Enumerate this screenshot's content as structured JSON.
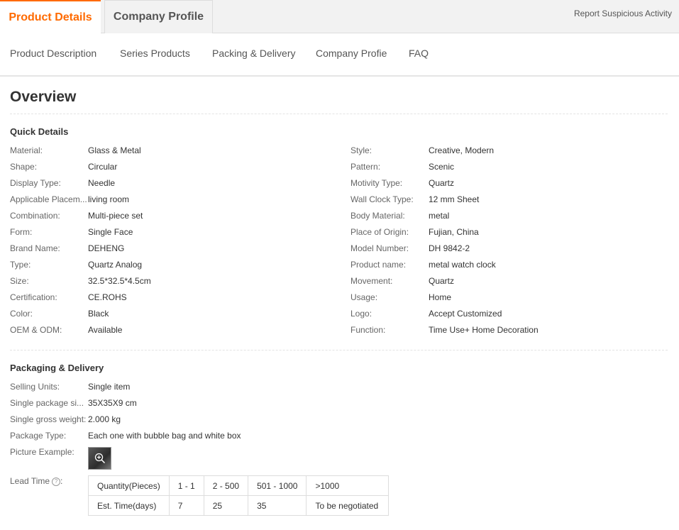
{
  "tabs": {
    "active": "Product Details",
    "company": "Company Profile"
  },
  "report_link": "Report Suspicious Activity",
  "subnav": [
    "Product Description",
    "Series Products",
    "Packing & Delivery",
    "Company Profie",
    "FAQ"
  ],
  "overview": {
    "title": "Overview"
  },
  "quick_details": {
    "title": "Quick Details",
    "left": [
      {
        "k": "Material:",
        "v": "Glass & Metal"
      },
      {
        "k": "Shape:",
        "v": "Circular"
      },
      {
        "k": "Display Type:",
        "v": "Needle"
      },
      {
        "k": "Applicable Placem...",
        "v": "living room"
      },
      {
        "k": "Combination:",
        "v": "Multi-piece set"
      },
      {
        "k": "Form:",
        "v": "Single Face"
      },
      {
        "k": "Brand Name:",
        "v": "DEHENG"
      },
      {
        "k": "Type:",
        "v": "Quartz Analog"
      },
      {
        "k": "Size:",
        "v": "32.5*32.5*4.5cm"
      },
      {
        "k": "Certification:",
        "v": "CE.ROHS"
      },
      {
        "k": "Color:",
        "v": "Black"
      },
      {
        "k": "OEM & ODM:",
        "v": "Available"
      }
    ],
    "right": [
      {
        "k": "Style:",
        "v": "Creative, Modern"
      },
      {
        "k": "Pattern:",
        "v": "Scenic"
      },
      {
        "k": "Motivity Type:",
        "v": "Quartz"
      },
      {
        "k": "Wall Clock Type:",
        "v": "12 mm Sheet"
      },
      {
        "k": "Body Material:",
        "v": "metal"
      },
      {
        "k": "Place of Origin:",
        "v": "Fujian, China"
      },
      {
        "k": "Model Number:",
        "v": "DH 9842-2"
      },
      {
        "k": "Product name:",
        "v": "metal watch clock"
      },
      {
        "k": "Movement:",
        "v": "Quartz"
      },
      {
        "k": "Usage:",
        "v": "Home"
      },
      {
        "k": "Logo:",
        "v": "Accept Customized"
      },
      {
        "k": "Function:",
        "v": "Time Use+ Home Decoration"
      }
    ]
  },
  "packaging": {
    "title": "Packaging & Delivery",
    "rows": [
      {
        "k": "Selling Units:",
        "v": "Single item"
      },
      {
        "k": "Single package si...",
        "v": "35X35X9 cm"
      },
      {
        "k": "Single gross weight:",
        "v": "2.000 kg"
      },
      {
        "k": "Package Type:",
        "v": "Each one with bubble bag and white box"
      },
      {
        "k": "Picture Example:",
        "v": ""
      }
    ],
    "picture_icon": "zoom-in-icon",
    "lead_time": {
      "label": "Lead Time",
      "help_icon": "help-icon",
      "rows": [
        [
          "Quantity(Pieces)",
          "1 - 1",
          "2 - 500",
          "501 - 1000",
          ">1000"
        ],
        [
          "Est. Time(days)",
          "7",
          "25",
          "35",
          "To be negotiated"
        ]
      ]
    }
  },
  "colors": {
    "accent": "#ff6a00"
  }
}
